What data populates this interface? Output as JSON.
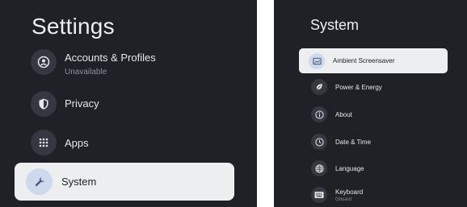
{
  "left_panel": {
    "title": "Settings",
    "items": [
      {
        "label": "Accounts & Profiles",
        "sublabel": "Unavailable",
        "icon": "account-icon"
      },
      {
        "label": "Privacy",
        "icon": "shield-icon"
      },
      {
        "label": "Apps",
        "icon": "apps-grid-icon"
      },
      {
        "label": "System",
        "icon": "wrench-icon",
        "selected": true
      }
    ]
  },
  "right_panel": {
    "title": "System",
    "items": [
      {
        "label": "Ambient Screensaver",
        "icon": "screensaver-icon",
        "selected": true
      },
      {
        "label": "Power & Energy",
        "icon": "leaf-icon"
      },
      {
        "label": "About",
        "icon": "info-icon"
      },
      {
        "label": "Date & Time",
        "icon": "clock-icon"
      },
      {
        "label": "Language",
        "icon": "globe-icon"
      },
      {
        "label": "Keyboard",
        "sublabel": "Gboard",
        "icon": "keyboard-icon"
      }
    ]
  },
  "colors": {
    "panel_bg": "#1f2126",
    "selected_bg": "#eceef0",
    "selected_icon_bg": "#cfd9ee",
    "icon_bg": "#353840"
  }
}
